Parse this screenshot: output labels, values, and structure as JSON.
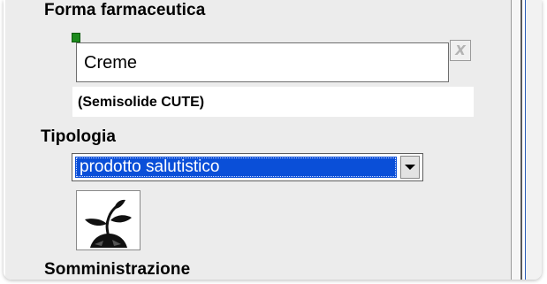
{
  "form": {
    "forma_farmaceutica": {
      "label": "Forma farmaceutica",
      "value": "Creme",
      "clear_icon": "x-clear-icon",
      "subnote": "(Semisolide CUTE)"
    },
    "tipologia": {
      "label": "Tipologia",
      "selected": "prodotto salutistico",
      "icon": "plant-sprout-icon"
    },
    "somministrazione": {
      "label": "Somministrazione"
    }
  },
  "colors": {
    "selection": "#0a4fd8",
    "marker": "#1c8a1c",
    "panel": "#ececec"
  }
}
